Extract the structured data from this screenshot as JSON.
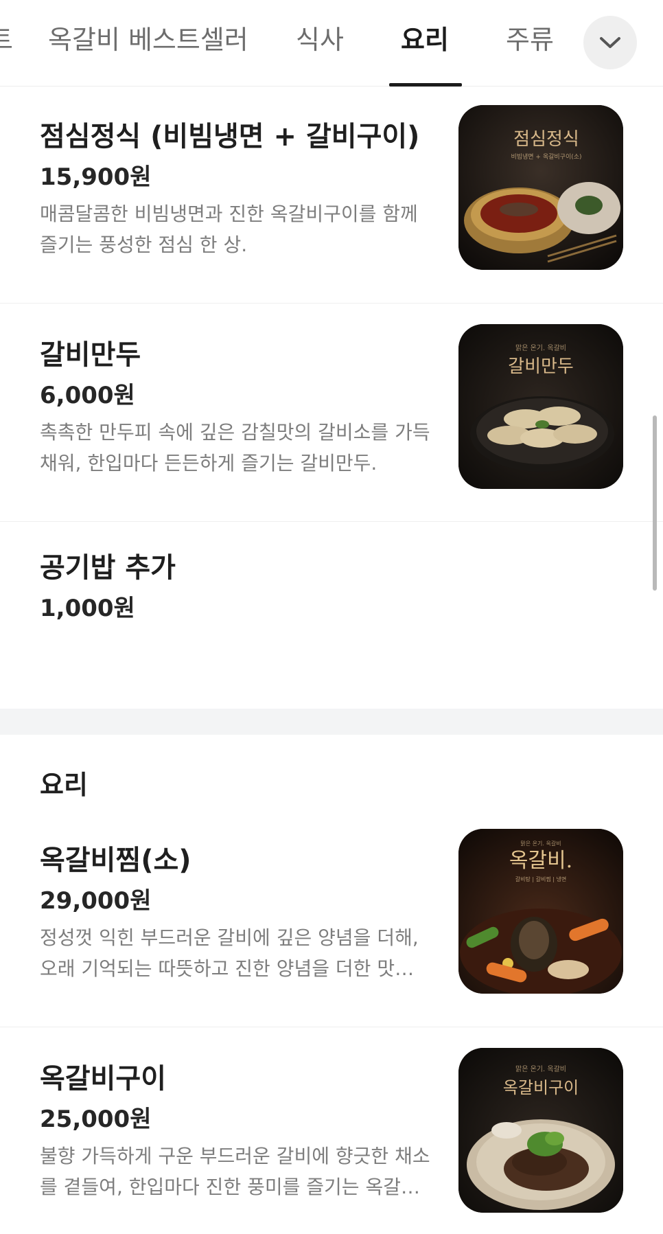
{
  "tabs": [
    {
      "label": "트"
    },
    {
      "label": "옥갈비 베스트셀러"
    },
    {
      "label": "식사"
    },
    {
      "label": "요리",
      "active": true
    },
    {
      "label": "주류"
    }
  ],
  "more_icon": "chevron-down-icon",
  "items": [
    {
      "name": "점심정식 (비빔냉면 + 갈비구이)",
      "price": "15,900원",
      "desc": "매콤달콤한 비빔냉면과 진한 옥갈비구이를 함께 즐기는 풍성한 점심 한 상.",
      "image": {
        "title": "점심정식",
        "subtitle": "비빔냉면 + 옥갈비구이(소)"
      }
    },
    {
      "name": "갈비만두",
      "price": "6,000원",
      "desc": "촉촉한 만두피 속에 깊은 감칠맛의 갈비소를 가득 채워, 한입마다 든든하게 즐기는 갈비만두.",
      "image": {
        "title": "갈비만두",
        "tagline": "맑은 온기. 옥갈비"
      }
    },
    {
      "name": "공기밥 추가",
      "price": "1,000원"
    }
  ],
  "section": {
    "title": "요리"
  },
  "section_items": [
    {
      "name": "옥갈비찜(소)",
      "price": "29,000원",
      "desc": "정성껏 익힌 부드러운 갈비에 깊은 양념을 더해, 오래 기억되는 따뜻하고 진한 양념을 더한 맛을 선사합니다.",
      "image": {
        "title": "옥갈비.",
        "tagline": "맑은 온기. 옥갈비",
        "subtitle": "갈비탕 | 갈비찜 | 냉면"
      }
    },
    {
      "name": "옥갈비구이",
      "price": "25,000원",
      "desc": "불향 가득하게 구운 부드러운 갈비에 향긋한 채소를 곁들여, 한입마다 진한 풍미를 즐기는 옥갈비구이.",
      "image": {
        "title": "옥갈비구이",
        "tagline": "맑은 온기. 옥갈비"
      }
    }
  ],
  "colors": {
    "accent_text": "#1c1c1c",
    "muted_text": "#7d7d7d",
    "gold": "#c9a46a"
  }
}
